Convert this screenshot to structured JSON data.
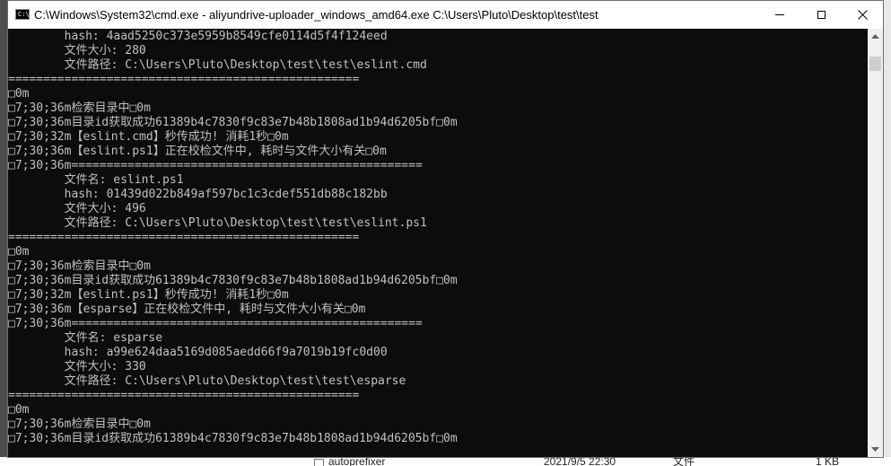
{
  "window": {
    "title": "C:\\Windows\\System32\\cmd.exe - aliyundrive-uploader_windows_amd64.exe  C:\\Users\\Pluto\\Desktop\\test\\test",
    "icon": "cmd-icon",
    "icon_text": "C:\\"
  },
  "console_lines": [
    "        hash: 4aad5250c373e5959b8549cfe0114d5f4f124eed",
    "        文件大小: 280",
    "        文件路径: C:\\Users\\Pluto\\Desktop\\test\\test\\eslint.cmd",
    "==================================================",
    "□0m",
    "□7;30;36m检索目录中□0m",
    "□7;30;36m目录id获取成功61389b4c7830f9c83e7b48b1808ad1b94d6205bf□0m",
    "□7;30;32m【eslint.cmd】秒传成功! 消耗1秒□0m",
    "□7;30;36m【eslint.ps1】正在校检文件中, 耗时与文件大小有关□0m",
    "□7;30;36m==================================================",
    "        文件名: eslint.ps1",
    "        hash: 01439d022b849af597bc1c3cdef551db88c182bb",
    "        文件大小: 496",
    "        文件路径: C:\\Users\\Pluto\\Desktop\\test\\test\\eslint.ps1",
    "==================================================",
    "□0m",
    "□7;30;36m检索目录中□0m",
    "□7;30;36m目录id获取成功61389b4c7830f9c83e7b48b1808ad1b94d6205bf□0m",
    "□7;30;32m【eslint.ps1】秒传成功! 消耗1秒□0m",
    "□7;30;36m【esparse】正在校检文件中, 耗时与文件大小有关□0m",
    "□7;30;36m==================================================",
    "        文件名: esparse",
    "        hash: a99e624daa5169d085aedd66f9a7019b19fc0d00",
    "        文件大小: 330",
    "        文件路径: C:\\Users\\Pluto\\Desktop\\test\\test\\esparse",
    "==================================================",
    "□0m",
    "□7;30;36m检索目录中□0m",
    "□7;30;36m目录id获取成功61389b4c7830f9c83e7b48b1808ad1b94d6205bf□0m"
  ],
  "background_row": {
    "name": "autoprefixer",
    "date": "2021/9/5 22:30",
    "type": "文件",
    "size": "1 KB"
  }
}
